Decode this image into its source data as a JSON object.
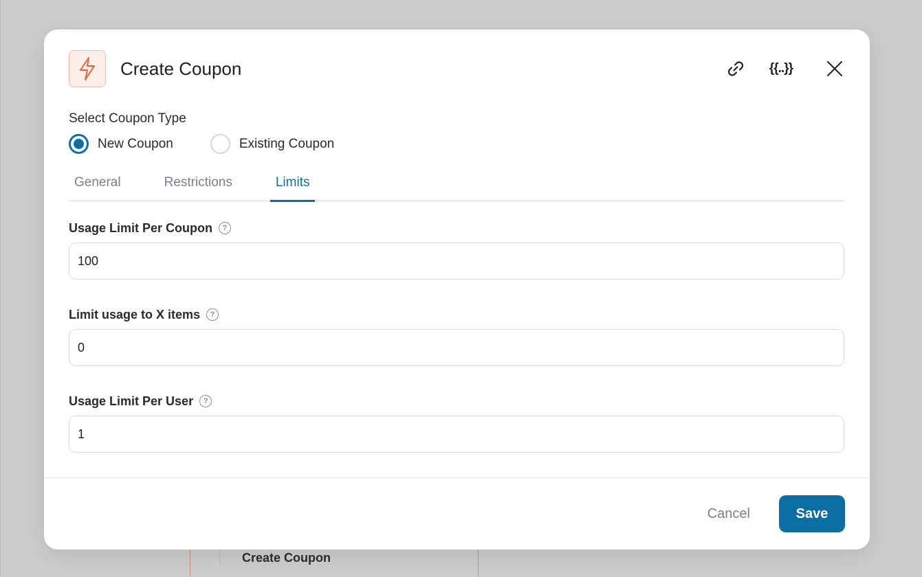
{
  "background": {
    "card_label": "Create Coupon"
  },
  "header": {
    "title": "Create Coupon",
    "logo_icon": "lightning-bolt-icon",
    "link_icon": "link-icon",
    "variables_label": "{{..}}",
    "close_icon": "close-icon"
  },
  "coupon_type": {
    "label": "Select Coupon Type",
    "options": [
      {
        "label": "New Coupon",
        "checked": true
      },
      {
        "label": "Existing Coupon",
        "checked": false
      }
    ]
  },
  "tabs": [
    {
      "label": "General",
      "active": false
    },
    {
      "label": "Restrictions",
      "active": false
    },
    {
      "label": "Limits",
      "active": true
    }
  ],
  "fields": {
    "usage_limit_per_coupon": {
      "label": "Usage Limit Per Coupon",
      "value": "100",
      "help": "?"
    },
    "limit_usage_items": {
      "label": "Limit usage to X items",
      "value": "0",
      "help": "?"
    },
    "usage_limit_per_user": {
      "label": "Usage Limit Per User",
      "value": "1",
      "help": "?"
    }
  },
  "footer": {
    "cancel_label": "Cancel",
    "save_label": "Save"
  },
  "colors": {
    "accent": "#0b6fa4",
    "logo_bg": "#fdeeea",
    "logo_icon": "#e8633f"
  }
}
